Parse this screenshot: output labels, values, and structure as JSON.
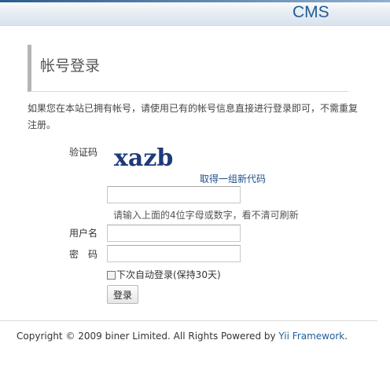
{
  "header": {
    "logo": "CMS"
  },
  "page": {
    "title": "帐号登录",
    "intro": "如果您在本站已拥有帐号，请使用已有的帐号信息直接进行登录即可，不需重复注册。"
  },
  "form": {
    "captcha_label": "验证码",
    "captcha_text": "xazb",
    "refresh_link": "取得一组新代码",
    "captcha_value": "",
    "captcha_hint": "请输入上面的4位字母或数字，看不清可刷新",
    "username_label": "用户名",
    "username_value": "",
    "password_label": "密　码",
    "password_value": "",
    "remember_label": "下次自动登录(保持30天)",
    "remember_checked": false,
    "submit_label": "登录"
  },
  "footer": {
    "copyright": "Copyright © 2009 biner Limited. All Rights Powered by ",
    "link_text": "Yii Framework",
    "suffix": "."
  },
  "colors": {
    "accent": "#1f5d98",
    "link": "#1f4e8c",
    "heading_border": "#b5b5b5"
  }
}
